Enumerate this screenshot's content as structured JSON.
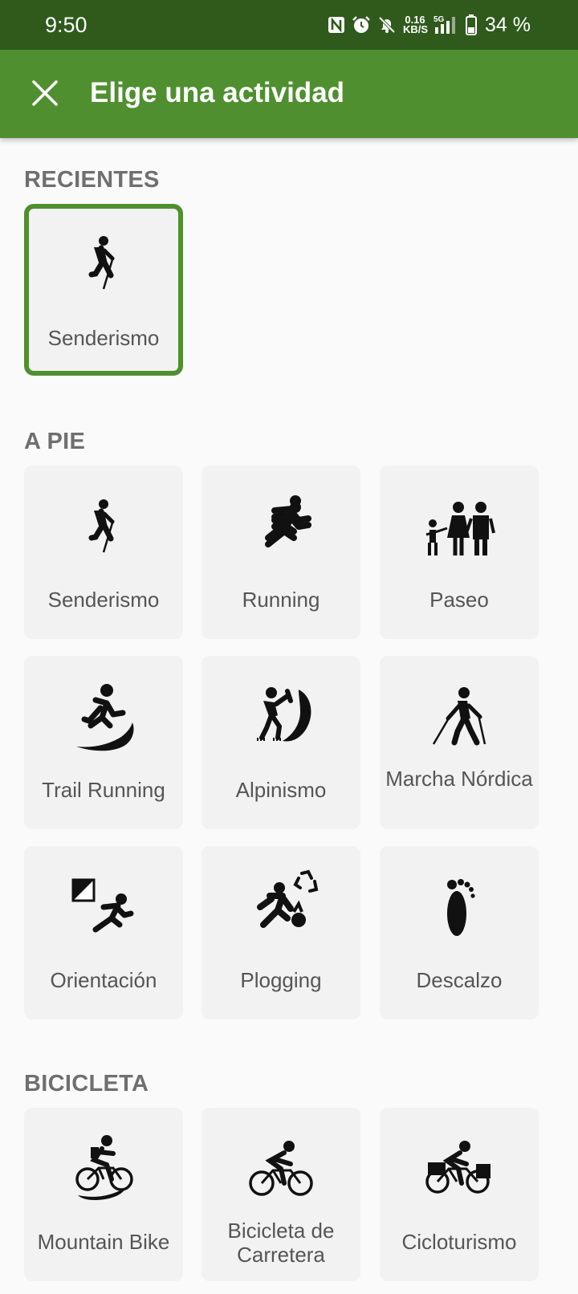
{
  "status_bar": {
    "time": "9:50",
    "net_speed_value": "0.16",
    "net_speed_unit": "KB/S",
    "network": "5G",
    "battery": "34 %"
  },
  "app_bar": {
    "title": "Elige una actividad",
    "close_icon": "close-icon"
  },
  "colors": {
    "status_bar": "#2f5a1c",
    "app_bar": "#4f8f2f",
    "selected_border": "#4f8f2f",
    "section_title": "#6f6f6f",
    "card_bg": "#f2f2f2"
  },
  "sections": {
    "recientes": {
      "title": "RECIENTES",
      "items": [
        {
          "label": "Senderismo",
          "icon": "hiker-icon",
          "selected": true
        }
      ]
    },
    "a_pie": {
      "title": "A PIE",
      "items": [
        {
          "label": "Senderismo",
          "icon": "hiker-icon"
        },
        {
          "label": "Running",
          "icon": "runner-icon"
        },
        {
          "label": "Paseo",
          "icon": "family-icon"
        },
        {
          "label": "Trail Running",
          "icon": "trail-runner-icon"
        },
        {
          "label": "Alpinismo",
          "icon": "mountaineer-icon"
        },
        {
          "label": "Marcha Nórdica",
          "icon": "nordic-walker-icon"
        },
        {
          "label": "Orientación",
          "icon": "orienteering-icon"
        },
        {
          "label": "Plogging",
          "icon": "plogging-icon"
        },
        {
          "label": "Descalzo",
          "icon": "footprint-icon"
        }
      ]
    },
    "bicicleta": {
      "title": "BICICLETA",
      "items": [
        {
          "label": "Mountain Bike",
          "icon": "mountain-bike-icon"
        },
        {
          "label": "Bicicleta de Carretera",
          "icon": "road-bike-icon"
        },
        {
          "label": "Cicloturismo",
          "icon": "touring-bike-icon"
        }
      ]
    }
  }
}
